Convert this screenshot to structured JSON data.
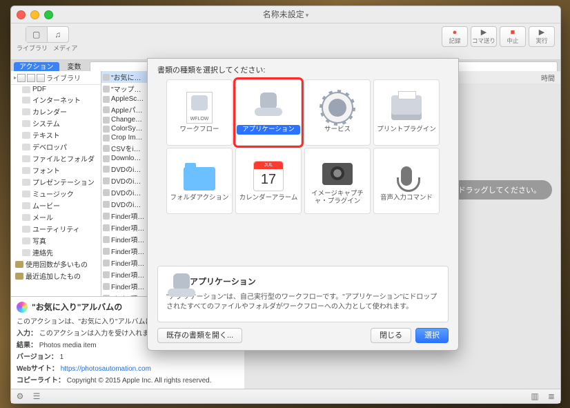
{
  "window": {
    "title": "名称未設定"
  },
  "toolbar": {
    "left_tabs": [
      "ライブラリ",
      "メディア"
    ],
    "right_buttons": [
      {
        "icon": "●",
        "label": "記録",
        "cls": "rec"
      },
      {
        "icon": "▶",
        "label": "コマ送り",
        "cls": "play"
      },
      {
        "icon": "■",
        "label": "中止",
        "cls": "stop"
      },
      {
        "icon": "▶",
        "label": "実行",
        "cls": "play"
      }
    ]
  },
  "subbar": {
    "tabs": [
      "アクション",
      "変数"
    ],
    "active": 0
  },
  "library": {
    "header": "ライブラリ",
    "items": [
      "PDF",
      "インターネット",
      "カレンダー",
      "システム",
      "テキスト",
      "デベロッパ",
      "ファイルとフォルダ",
      "フォント",
      "プレゼンテーション",
      "ミュージック",
      "ムービー",
      "メール",
      "ユーティリティ",
      "写真",
      "連絡先"
    ],
    "extras": [
      "使用回数が多いもの",
      "最近追加したもの"
    ]
  },
  "actions": [
    "\"お気に…",
    "\"マップ…",
    "AppleSc…",
    "Appleパ…",
    "Change…",
    "ColorSy…",
    "Crop Im…",
    "CSVをi…",
    "Downlo…",
    "DVDのi…",
    "DVDのi…",
    "DVDのi…",
    "DVDのi…",
    "Finder項…",
    "Finder項…",
    "Finder項…",
    "Finder項…",
    "Finder項…",
    "Finder項…",
    "Finder項…",
    "Finder項…",
    "Finder項…",
    "Finder項…"
  ],
  "info": {
    "title": "\"お気に入り\"アルバムの",
    "subtitle": "このアクションは、\"お気に入り\"アルバムに含ま…返します。",
    "lines": [
      [
        "入力：",
        "このアクションは入力を受け入れません"
      ],
      [
        "結果：",
        "Photos media item"
      ],
      [
        "バージョン：",
        "1"
      ],
      [
        "Webサイト：",
        "https://photosautomation.com"
      ],
      [
        "コピーライト：",
        "Copyright © 2015 Apple Inc. All rights reserved."
      ]
    ]
  },
  "canvas": {
    "header": "時間",
    "ghost": "イルをドラッグしてください。"
  },
  "modal": {
    "header": "書類の種類を選択してください:",
    "options": [
      {
        "key": "workflow",
        "label": "ワークフロー",
        "icon": "wflowdoc"
      },
      {
        "key": "application",
        "label": "アプリケーション",
        "icon": "automator",
        "selected": true
      },
      {
        "key": "service",
        "label": "サービス",
        "icon": "gear"
      },
      {
        "key": "printplugin",
        "label": "プリントプラグイン",
        "icon": "printer"
      },
      {
        "key": "folderaction",
        "label": "フォルダアクション",
        "icon": "folder"
      },
      {
        "key": "calalarm",
        "label": "カレンダーアラーム",
        "icon": "cal"
      },
      {
        "key": "imagecapture",
        "label": "イメージキャプチャ・プラグイン",
        "icon": "cam"
      },
      {
        "key": "dictation",
        "label": "音声入力コマンド",
        "icon": "mic"
      }
    ],
    "desc": {
      "title": "アプリケーション",
      "body": "\"アプリケーション\"は、自己実行型のワークフローです。\"アプリケーション\"にドロップされたすべてのファイルやフォルダがワークフローへの入力として使われます。"
    },
    "footer": {
      "open": "既存の書類を開く...",
      "close": "閉じる",
      "choose": "選択"
    }
  },
  "cal": {
    "month": "JUL",
    "day": "17"
  }
}
